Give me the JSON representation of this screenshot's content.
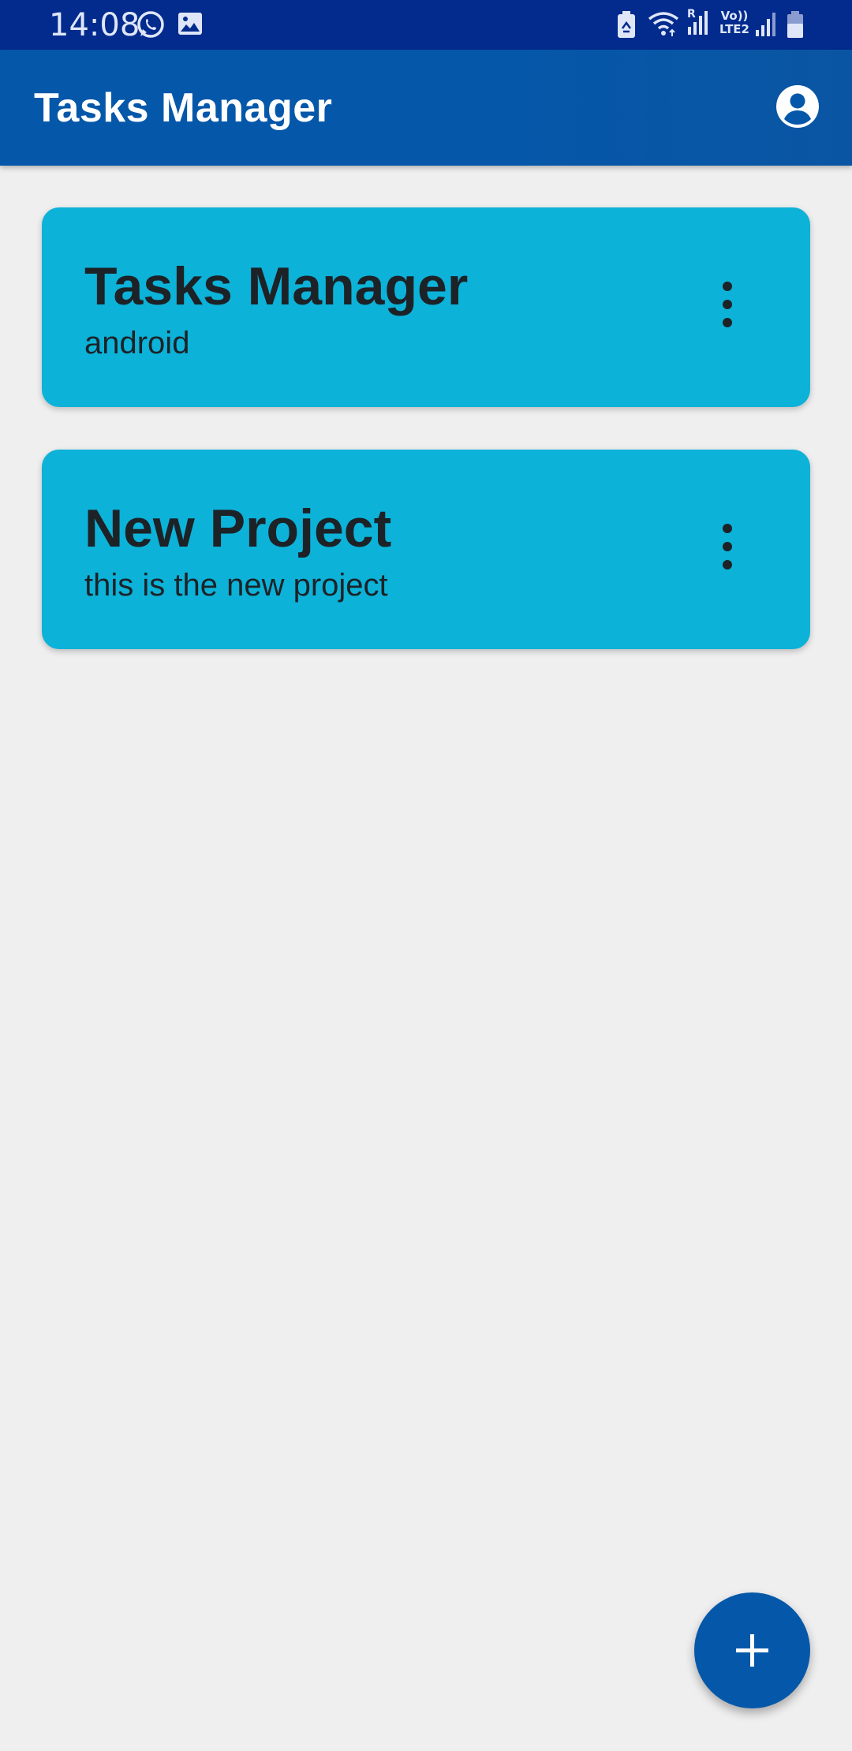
{
  "status_bar": {
    "time": "14:08",
    "icons": [
      "whatsapp-icon",
      "gallery-icon",
      "battery-saver-icon",
      "wifi-icon",
      "signal-roaming-icon",
      "volte-lte2-icon",
      "signal-icon",
      "battery-icon"
    ],
    "volte_label": "Vo))",
    "lte_label": "LTE2",
    "roaming_label": "R"
  },
  "app_bar": {
    "title": "Tasks Manager",
    "account_icon": "account-circle-icon"
  },
  "projects": [
    {
      "title": "Tasks Manager",
      "subtitle": "android"
    },
    {
      "title": "New Project",
      "subtitle": "this is the new project"
    }
  ],
  "fab": {
    "icon": "plus-icon"
  },
  "colors": {
    "status_bar": "#022b8d",
    "app_bar": "#0557a9",
    "card": "#0cb2d8",
    "background": "#efeff0",
    "fab": "#0558a9",
    "card_text": "#1d2227"
  }
}
